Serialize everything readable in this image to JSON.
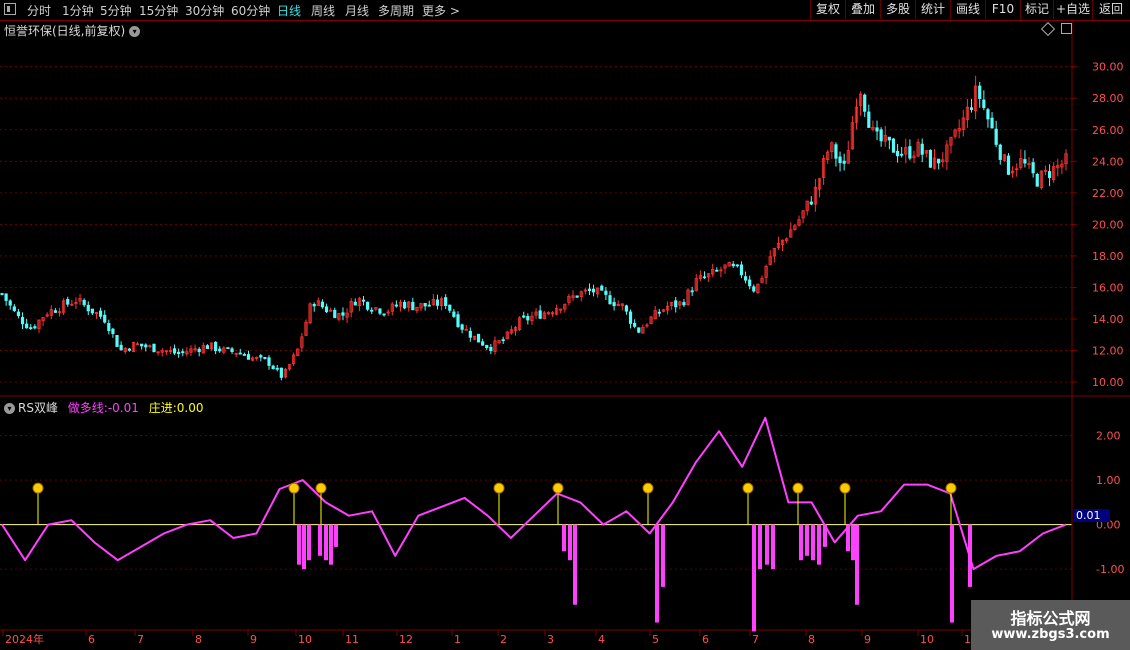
{
  "toolbar": {
    "periods": [
      "分时",
      "1分钟",
      "5分钟",
      "15分钟",
      "30分钟",
      "60分钟",
      "日线",
      "周线",
      "月线",
      "多周期",
      "更多"
    ],
    "active_period": "日线",
    "right_buttons": [
      "复权",
      "叠加",
      "多股",
      "统计",
      "画线",
      "F10",
      "标记",
      "+自选",
      "返回"
    ]
  },
  "main_chart": {
    "title": "恒誉环保(日线,前复权)",
    "y_ticks": [
      "30.00",
      "28.00",
      "26.00",
      "24.00",
      "22.00",
      "20.00",
      "18.00",
      "16.00",
      "14.00",
      "12.00",
      "10.00"
    ]
  },
  "indicator": {
    "name": "RS双峰",
    "line1_label": "做多线:",
    "line1_value": "-0.01",
    "line2_label": "庄进:",
    "line2_value": "0.00",
    "current_value_badge": "0.01",
    "y_ticks": [
      "2.00",
      "1.00",
      "0.00",
      "-1.00"
    ]
  },
  "x_axis": {
    "labels": [
      "2024年",
      "6",
      "7",
      "8",
      "9",
      "10",
      "11",
      "12",
      "1",
      "2",
      "3",
      "4",
      "5",
      "6",
      "7",
      "8",
      "9",
      "10",
      "11"
    ]
  },
  "watermark": {
    "line1": "指标公式网",
    "line2": "www.zbgs3.com"
  },
  "colors": {
    "up": "#ff3232",
    "down": "#54fcfc",
    "indicator_line": "#ff40ff",
    "signal": "#ffff00",
    "grid": "#800000"
  },
  "chart_data": [
    {
      "type": "candlestick",
      "title": "恒誉环保(日线,前复权)",
      "ylim": [
        9.5,
        31.5
      ],
      "close_series": [
        15.6,
        14.2,
        13.4,
        14.4,
        14.8,
        15.2,
        14.6,
        14.0,
        12.0,
        12.4,
        12.2,
        12.0,
        11.8,
        12.1,
        12.3,
        12.0,
        11.9,
        11.5,
        11.3,
        10.3,
        12.0,
        15.2,
        14.6,
        14.2,
        15.3,
        14.8,
        14.5,
        15.0,
        14.8,
        14.9,
        15.1,
        13.6,
        12.8,
        12.2,
        12.7,
        13.8,
        14.2,
        14.5,
        15.0,
        15.6,
        15.8,
        15.3,
        14.8,
        13.2,
        14.1,
        14.8,
        15.0,
        16.4,
        16.8,
        17.3,
        17.0,
        15.8,
        18.0,
        19.2,
        20.4,
        22.0,
        25.0,
        23.5,
        29.0,
        25.5,
        25.0,
        24.5,
        24.8,
        23.8,
        24.6,
        26.5,
        28.5,
        26.0,
        23.5,
        24.0,
        22.8,
        23.4,
        24.0
      ],
      "x_range": [
        "2024年",
        "11"
      ]
    },
    {
      "type": "line",
      "title": "RS双峰",
      "series": [
        {
          "name": "做多线",
          "last_value": -0.01
        },
        {
          "name": "庄进",
          "last_value": 0.0
        }
      ],
      "ylim": [
        -2.3,
        2.8
      ],
      "line_values": [
        0.0,
        -0.8,
        0.0,
        0.1,
        -0.4,
        -0.8,
        -0.5,
        -0.2,
        0.0,
        0.1,
        -0.3,
        -0.2,
        0.8,
        1.0,
        0.5,
        0.2,
        0.3,
        -0.7,
        0.2,
        0.4,
        0.6,
        0.2,
        -0.3,
        0.2,
        0.7,
        0.5,
        0.0,
        0.3,
        -0.2,
        0.5,
        1.4,
        2.1,
        1.3,
        2.4,
        0.5,
        0.5,
        -0.4,
        0.2,
        0.3,
        0.9,
        0.9,
        0.7,
        -1.0,
        -0.7,
        -0.6,
        -0.2,
        0.0
      ],
      "signal_positions": [
        "5月",
        "10月",
        "10月",
        "2月",
        "2月",
        "5月",
        "6月",
        "7月",
        "7月",
        "8月",
        "10月"
      ],
      "bar_values": [
        -0.9,
        -1.0,
        -0.8,
        -0.7,
        -0.8,
        -0.9,
        -0.5,
        -0.6,
        -0.8,
        -1.8,
        -2.2,
        -1.4,
        -2.4,
        -1.0
      ]
    }
  ]
}
